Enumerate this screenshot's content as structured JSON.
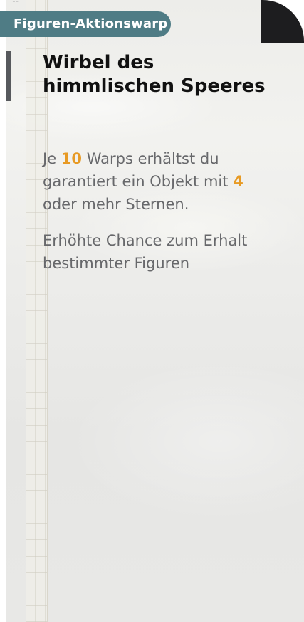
{
  "banner": {
    "tag_label": "Figuren-Aktionswarp",
    "title_line1": "Wirbel des",
    "title_line2": "himmlischen Speeres"
  },
  "info": {
    "guarantee_prefix": "Je",
    "guarantee_count": "10",
    "guarantee_mid": "Warps erhältst du garantiert ein Objekt mit",
    "guarantee_stars": "4",
    "guarantee_suffix": "oder mehr Sternen.",
    "rate_up_text": "Erhöhte Chance zum Erhalt bestimmter Figuren"
  },
  "colors": {
    "tag_bg": "#4f7c85",
    "highlight": "#e79a24",
    "text": "#67686b",
    "title": "#111111"
  },
  "icons": {
    "details": "list-icon"
  }
}
